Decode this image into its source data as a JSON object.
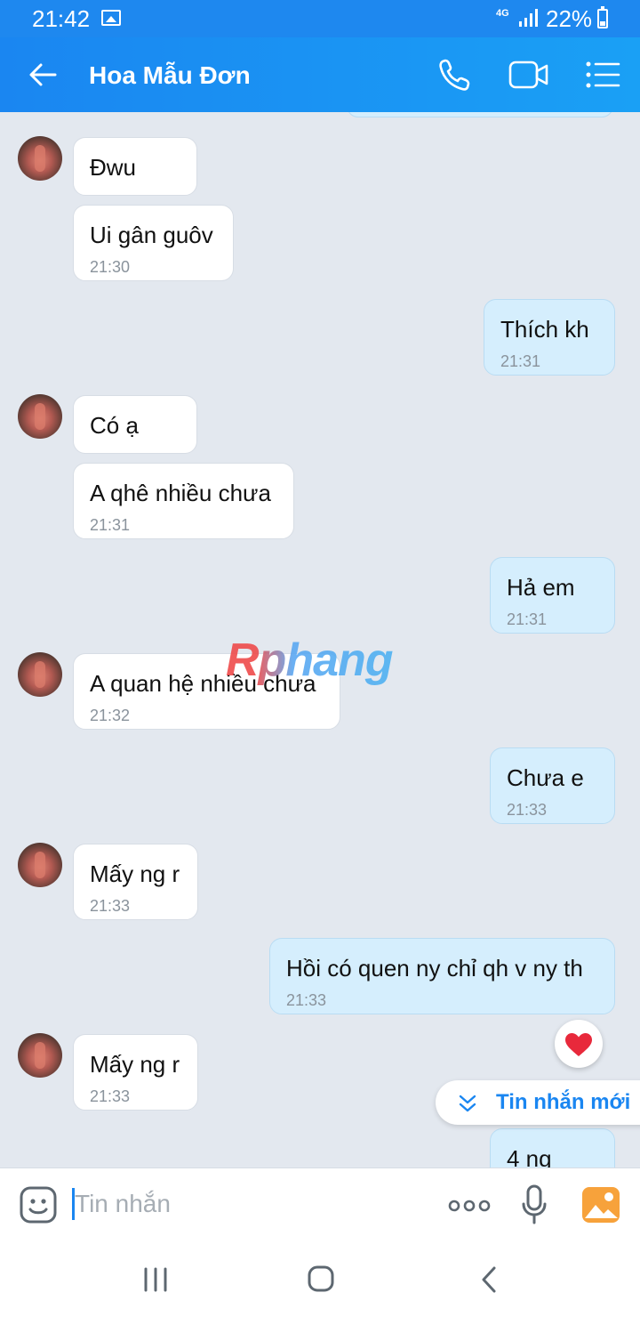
{
  "status_bar": {
    "time": "21:42",
    "network": "4G",
    "battery": "22%"
  },
  "header": {
    "title": "Hoa Mẫu Đơn",
    "icons": [
      "back-arrow-icon",
      "phone-icon",
      "video-call-icon",
      "menu-list-icon"
    ]
  },
  "messages": [
    {
      "side": "in",
      "text": "Đwu",
      "time": ""
    },
    {
      "side": "in",
      "text": "Ui gân guôv",
      "time": "21:30"
    },
    {
      "side": "out",
      "text": "Thích kh",
      "time": "21:31"
    },
    {
      "side": "in",
      "text": "Có ạ",
      "time": ""
    },
    {
      "side": "in",
      "text": "A qhê nhiều chưa",
      "time": "21:31"
    },
    {
      "side": "out",
      "text": "Hả em",
      "time": "21:31"
    },
    {
      "side": "in",
      "text": "A quan hệ nhiều chưa",
      "time": "21:32"
    },
    {
      "side": "out",
      "text": "Chưa e",
      "time": "21:33"
    },
    {
      "side": "in",
      "text": "Mấy ng r",
      "time": "21:33"
    },
    {
      "side": "out",
      "text": "Hồi có quen ny chỉ qh v ny th",
      "time": "21:33"
    },
    {
      "side": "in",
      "text": "Mấy ng r",
      "time": "21:33"
    },
    {
      "side": "out",
      "text": "4 ng",
      "time": ""
    }
  ],
  "watermark": "Rphang",
  "new_messages_label": "Tin nhắn mới",
  "input": {
    "placeholder": "Tin nhắn",
    "value": ""
  },
  "colors": {
    "accent": "#1a86f1",
    "bubble_out": "#d5eefd",
    "bubble_in": "#ffffff",
    "heart": "#e8293b"
  }
}
